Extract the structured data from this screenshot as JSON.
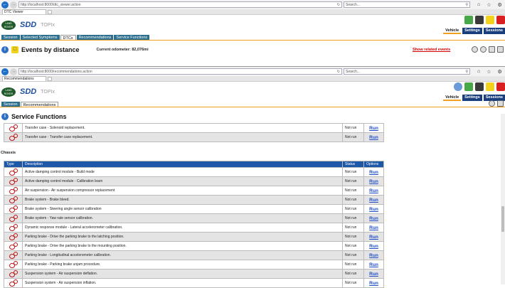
{
  "win1": {
    "url": "http://localhost:8000/dtc_viewer.action",
    "search_placeholder": "Search...",
    "tab_title": "DTC Viewer",
    "logo": "LAND ROVER",
    "brand": "SDD",
    "topix": "TOPIx",
    "toolbar": {
      "vehicle": "Vehicle",
      "settings": "Settings",
      "sessions": "Sessions"
    },
    "menu": [
      "Session",
      "Selected Symptoms",
      "DTCs",
      "Recommendations",
      "Service Functions"
    ],
    "active_menu": "DTCs",
    "title": "Events by distance",
    "odometer": "Current odometer: 82,076mi",
    "related_link": "Show related events"
  },
  "win2": {
    "url": "http://localhost:8000/recommendations.action",
    "search_placeholder": "Search...",
    "tab_title": "Recommendations",
    "logo": "LAND ROVER",
    "brand": "SDD",
    "topix": "TOPIx",
    "toolbar": {
      "vehicle": "Vehicle",
      "settings": "Settings",
      "sessions": "Sessions"
    },
    "menu": [
      "Session",
      "Recommendations"
    ],
    "active_menu": "Recommendations",
    "title": "Service Functions"
  },
  "top_rows": [
    {
      "desc": "Transfer case - Solenoid replacement.",
      "status": "Not run",
      "option": "Run"
    },
    {
      "desc": "Transfer case - Transfer case replacement.",
      "status": "Not run",
      "option": "Run"
    }
  ],
  "chassis": {
    "heading": "Chassis",
    "columns": {
      "type": "Type",
      "desc": "Description",
      "status": "Status",
      "options": "Options"
    },
    "rows": [
      {
        "desc": "Active damping control module - Build mode",
        "status": "Not run",
        "option": "Run"
      },
      {
        "desc": "Active damping control module - Calibration learn",
        "status": "Not run",
        "option": "Run"
      },
      {
        "desc": "Air suspension - Air suspension compressor replacement",
        "status": "Not run",
        "option": "Run"
      },
      {
        "desc": "Brake system - Brake bleed.",
        "status": "Not run",
        "option": "Run"
      },
      {
        "desc": "Brake system - Steering angle sensor calibration",
        "status": "Not run",
        "option": "Run"
      },
      {
        "desc": "Brake system - Yaw rate sensor calibration.",
        "status": "Not run",
        "option": "Run"
      },
      {
        "desc": "Dynamic response module - Lateral accelerometer calibration.",
        "status": "Not run",
        "option": "Run"
      },
      {
        "desc": "Parking brake - Drive the parking brake to the latching position.",
        "status": "Not run",
        "option": "Run"
      },
      {
        "desc": "Parking brake - Drive the parking brake to the mounting position.",
        "status": "Not run",
        "option": "Run"
      },
      {
        "desc": "Parking brake - Longitudinal accelerometer calibration.",
        "status": "Not run",
        "option": "Run"
      },
      {
        "desc": "Parking brake - Parking brake unjam procedure.",
        "status": "Not run",
        "option": "Run"
      },
      {
        "desc": "Suspension system - Air suspension deflation.",
        "status": "Not run",
        "option": "Run"
      },
      {
        "desc": "Suspension system - Air suspension inflation.",
        "status": "Not run",
        "option": "Run"
      }
    ]
  },
  "colors": {
    "accent_blue": "#1d58a8",
    "menu_teal": "#2d6f8e",
    "link_red": "#d40000",
    "tab_underline": "#f0a020"
  }
}
